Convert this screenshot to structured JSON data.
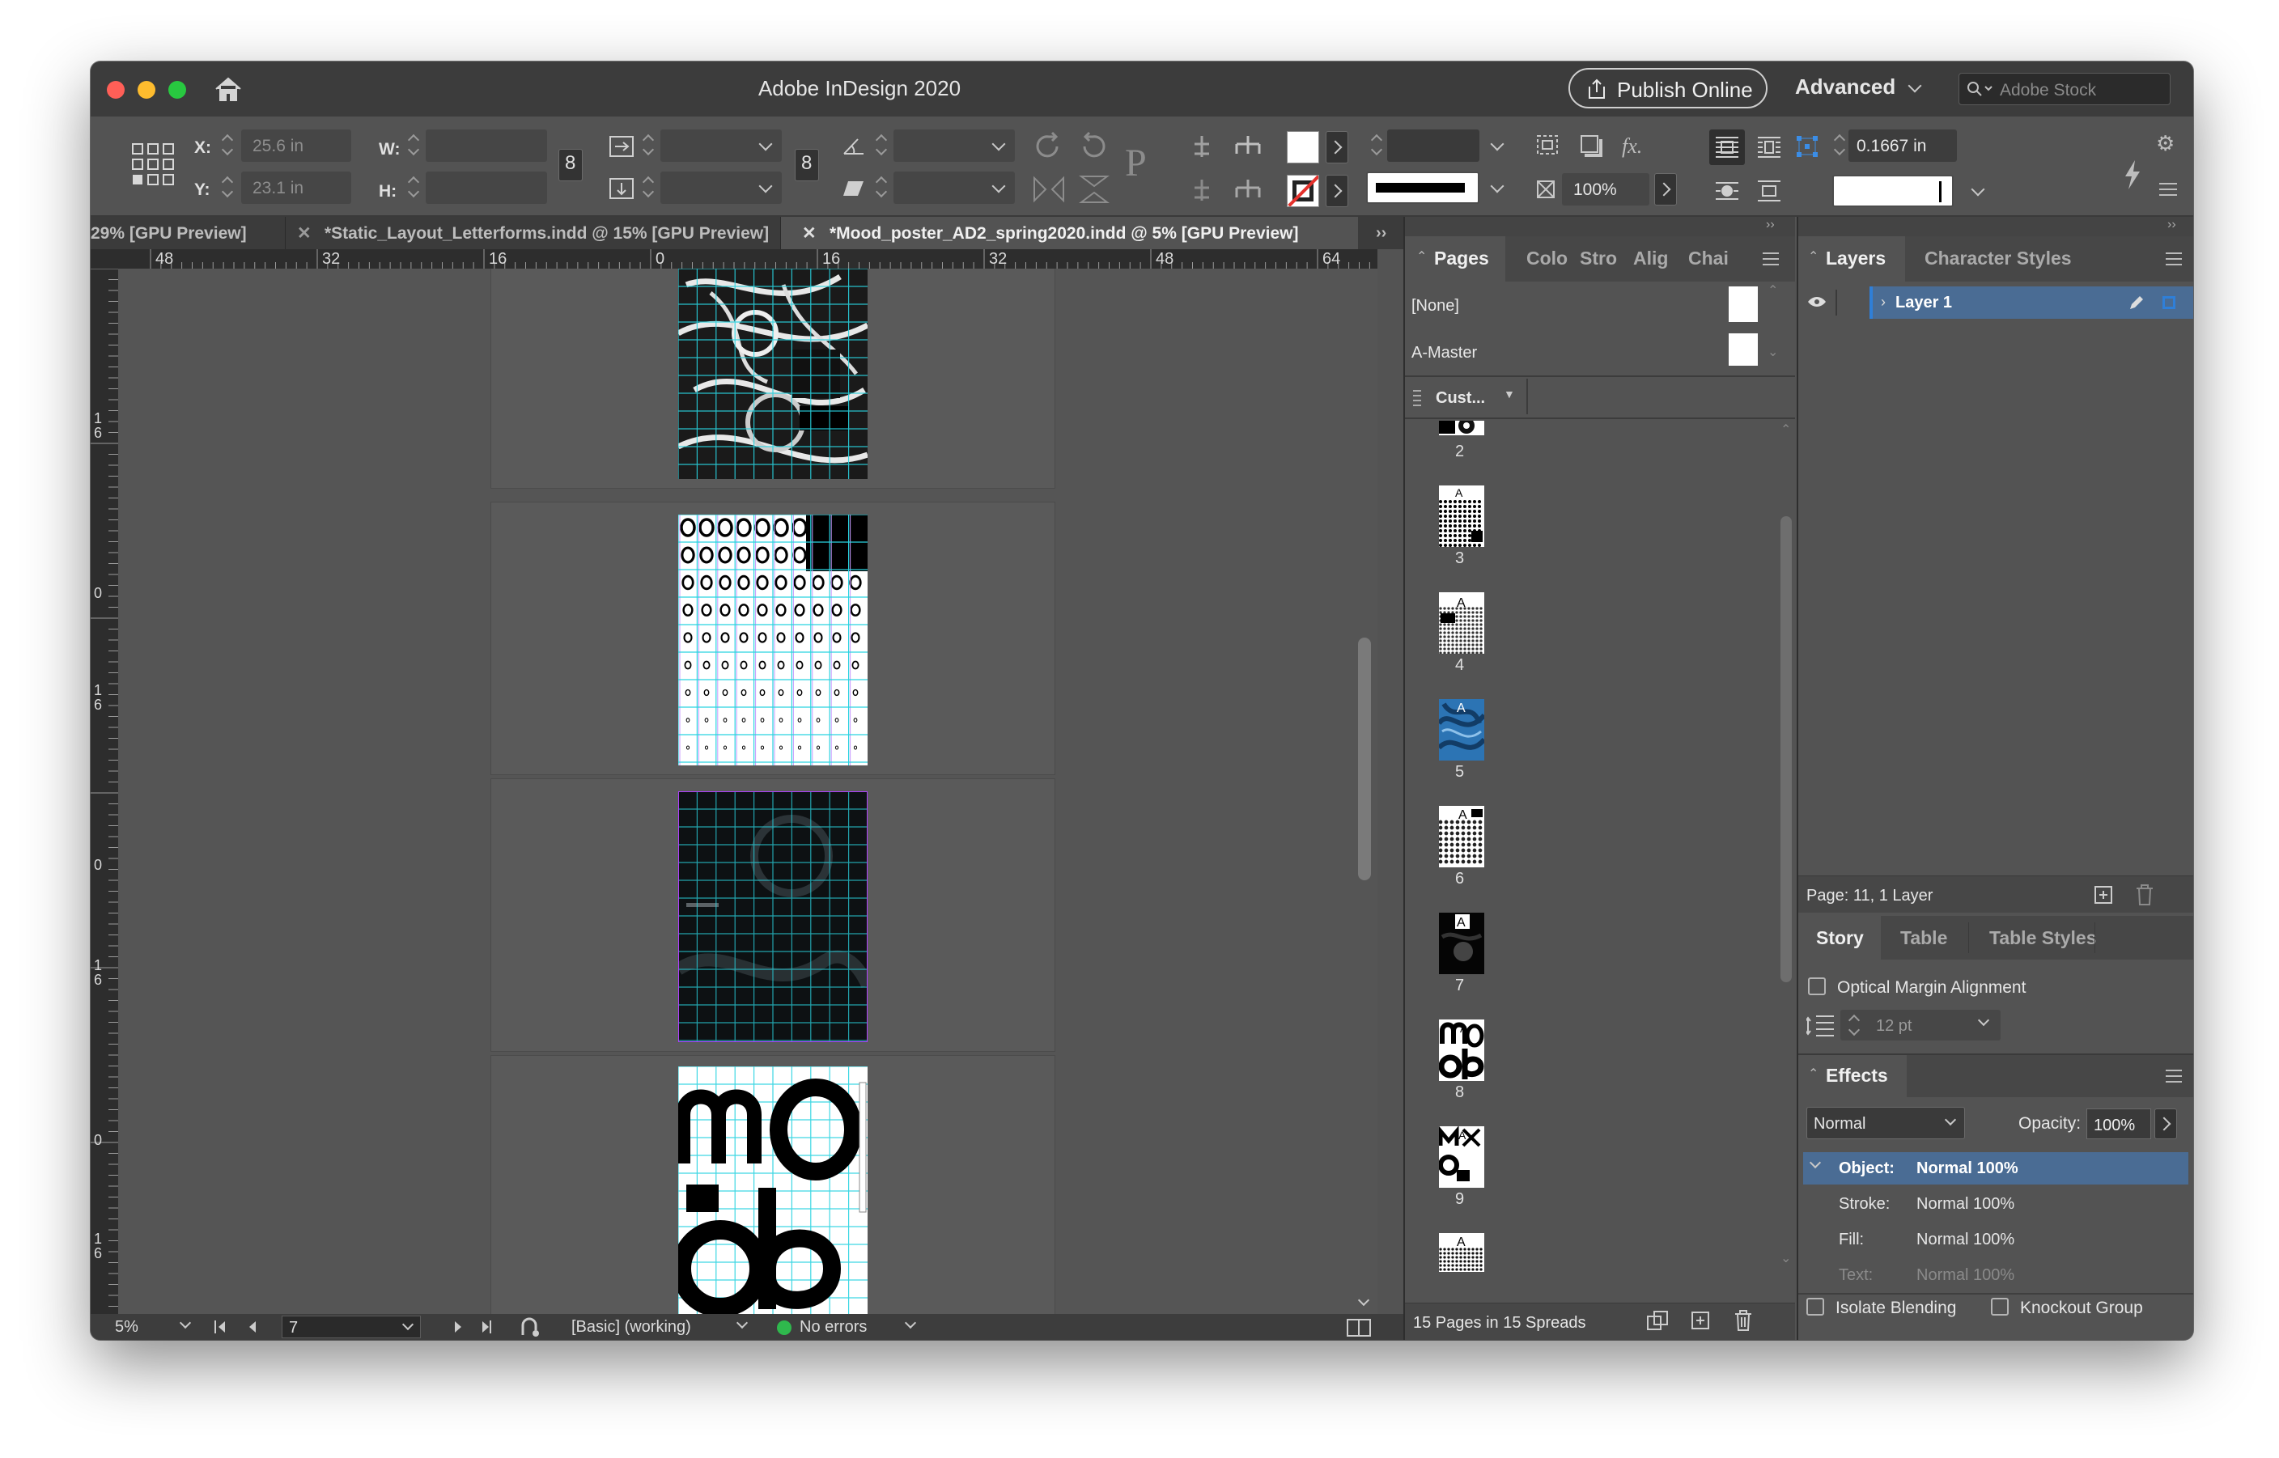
{
  "app": {
    "title": "Adobe InDesign 2020",
    "publish_label": "Publish Online",
    "workspace_label": "Advanced",
    "stock_placeholder": "Adobe Stock"
  },
  "control": {
    "x_label": "X:",
    "x_value": "25.6 in",
    "y_label": "Y:",
    "y_value": "23.1 in",
    "w_label": "W:",
    "h_label": "H:",
    "zoom_value": "100%",
    "stroke_weight": "0.1667 in"
  },
  "tabs": [
    {
      "label": "29% [GPU Preview]"
    },
    {
      "label": "*Static_Layout_Letterforms.indd @ 15% [GPU Preview]"
    },
    {
      "label": "*Mood_poster_AD2_spring2020.indd @ 5% [GPU Preview]"
    }
  ],
  "ruler": {
    "h_ticks": [
      "48",
      "32",
      "16",
      "0",
      "16",
      "32",
      "48",
      "64"
    ],
    "v_ticks": [
      "1\n6",
      "0",
      "1\n6",
      "0",
      "1\n6",
      "0",
      "1\n6"
    ]
  },
  "status": {
    "zoom": "5%",
    "page": "7",
    "preflight_profile": "[Basic] (working)",
    "preflight_status": "No errors"
  },
  "pages_panel": {
    "tabs": [
      "Pages",
      "Colo",
      "Stro",
      "Alig",
      "Chai"
    ],
    "masters": [
      "[None]",
      "A-Master"
    ],
    "view_label": "Cust...",
    "page_numbers": [
      "2",
      "3",
      "4",
      "5",
      "6",
      "7",
      "8",
      "9"
    ],
    "footer": "15 Pages in 15 Spreads"
  },
  "layers_panel": {
    "tabs": [
      "Layers",
      "Character Styles"
    ],
    "layer_name": "Layer 1",
    "footer": "Page: 11, 1 Layer"
  },
  "story_panel": {
    "tabs": [
      "Story",
      "Table",
      "Table Styles"
    ],
    "optical_margin": "Optical Margin Alignment",
    "size_value": "12 pt"
  },
  "effects_panel": {
    "title": "Effects",
    "blend_mode": "Normal",
    "opacity_label": "Opacity:",
    "opacity_value": "100%",
    "rows": [
      {
        "label": "Object:",
        "value": "Normal 100%"
      },
      {
        "label": "Stroke:",
        "value": "Normal 100%"
      },
      {
        "label": "Fill:",
        "value": "Normal 100%"
      },
      {
        "label": "Text:",
        "value": "Normal 100%"
      }
    ],
    "isolate_label": "Isolate Blending",
    "knockout_label": "Knockout Group"
  },
  "colors": {
    "window_bg": "#535353",
    "titlebar": "#3c3c3c",
    "selection": "#4a6c94",
    "accent_blue": "#2f7fd8",
    "guide_cyan": "#29d3e0"
  }
}
